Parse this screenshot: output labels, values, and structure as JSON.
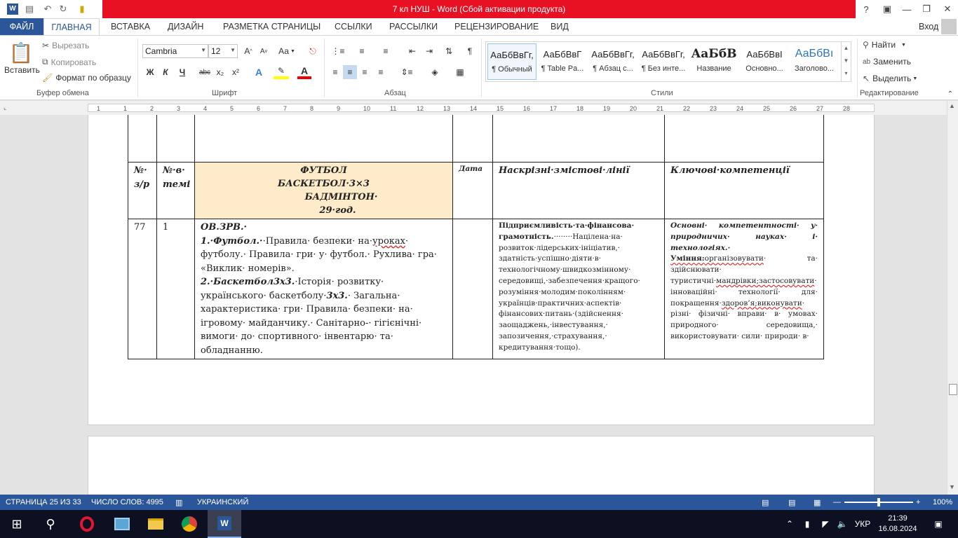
{
  "window": {
    "title": "7 кл НУШ -  Word (Сбой активации продукта)",
    "help": "?",
    "user": "Вход"
  },
  "ribbon_tabs": [
    {
      "label": "ФАЙЛ"
    },
    {
      "label": "ГЛАВНАЯ"
    },
    {
      "label": "ВСТАВКА"
    },
    {
      "label": "ДИЗАЙН"
    },
    {
      "label": "РАЗМЕТКА СТРАНИЦЫ"
    },
    {
      "label": "ССЫЛКИ"
    },
    {
      "label": "РАССЫЛКИ"
    },
    {
      "label": "РЕЦЕНЗИРОВАНИЕ"
    },
    {
      "label": "ВИД"
    }
  ],
  "clipboard": {
    "paste": "Вставить",
    "cut": "Вырезать",
    "copy": "Копировать",
    "format_painter": "Формат по образцу",
    "group": "Буфер обмена"
  },
  "font": {
    "name": "Cambria",
    "size": "12",
    "group": "Шрифт",
    "bold": "Ж",
    "italic": "К",
    "underline": "Ч",
    "strike": "abc",
    "sub": "x₂",
    "sup": "x²",
    "aa": "Аа"
  },
  "paragraph": {
    "group": "Абзац"
  },
  "styles": {
    "group": "Стили",
    "items": [
      {
        "preview": "АаБбВвГг,",
        "name": "¶ Обычный"
      },
      {
        "preview": "АаБбВвГ",
        "name": "¶ Table Pa..."
      },
      {
        "preview": "АаБбВвГг,",
        "name": "¶ Абзац с..."
      },
      {
        "preview": "АаБбВвГг,",
        "name": "¶ Без инте..."
      },
      {
        "preview": "АаБбВ",
        "name": "Название"
      },
      {
        "preview": "АаБбВвІ",
        "name": "Основно..."
      },
      {
        "preview": "АаБбВı",
        "name": "Заголово..."
      }
    ]
  },
  "editing": {
    "group": "Редактирование",
    "find": "Найти",
    "replace": "Заменить",
    "select": "Выделить"
  },
  "ruler": {
    "numbers": [
      "1",
      "1",
      "2",
      "3",
      "4",
      "5",
      "6",
      "7",
      "8",
      "9",
      "10",
      "11",
      "12",
      "13",
      "14",
      "15",
      "16",
      "17",
      "18",
      "19",
      "20",
      "21",
      "22",
      "23",
      "24",
      "25",
      "26",
      "27",
      "28"
    ]
  },
  "table": {
    "header": {
      "num": "№· з/р",
      "topic_num": "№·в· темі",
      "topic_lines": [
        "ФУТБОЛ",
        "БАСКЕТБОЛ·3×3",
        "БАДМІНТОН·",
        "29·год."
      ],
      "date": "Дата",
      "cross_lines": "Наскрізні·змістові·лінії",
      "competences": "Ключові·компетенції"
    },
    "row": {
      "num": "77",
      "topic_num": "1",
      "c_title": "ОВ.ЗРВ.·",
      "c_1_label": "1.·Футбол.·",
      "c_1_text": "·Правила· безпеки· на·",
      "c_1_ul": "уроках",
      "c_1_text2": "· футболу.· Правила· гри· у· футбол.· Рухлива· гра· «Виклик· номерів».",
      "c_2_label": "2.·Баскетбол",
      "c_2_bold": "3х3.",
      "c_2_text": "·Історія· розвитку· українського· баскетболу·",
      "c_2_bold2": "3х3.",
      "c_2_text2": "· Загальна· характеристика·  гри· Правила· безпеки· на· ігровому· майданчику.· Санітарно-· гігієнічні· вимоги· до· спортивного· інвентарю· та· обладнанню.",
      "cross_title": "Підприємливість·та·фінансова· грамотність.",
      "cross_text": "········Націлена·на· розвиток·лідерських·ініціатив,· здатність·успішно·діяти·в· технологічному·швидкозмінному· середовищі,·забезпечення·кращого· розуміння·молодим·поколінням· українців·практичних·аспектів· фінансових·питань·(здійснення· заощаджень,·інвестування,· запозичення,·страхування,· кредитування·тощо).",
      "comp_title": "Основні· компетентності· у· природничих· науках· і· технологіях.·",
      "comp_label": "Уміння:",
      "comp_ul1": "організовувати",
      "comp_text1": "· та· здійснювати· туристичні·",
      "comp_ul2": "мандрівки;застосовувати",
      "comp_text2": "· інноваційні· технології· для· покращення·",
      "comp_ul3": "здоров’я;виконувати",
      "comp_text3": "· різні· фізичні· вправи· в· умовах· природного· середовища,· використовувати· сили· природи· в·"
    }
  },
  "status": {
    "page": "СТРАНИЦА 25 ИЗ 33",
    "words": "ЧИСЛО СЛОВ: 4995",
    "lang": "УКРАИНСКИЙ",
    "zoom": "100%"
  },
  "taskbar": {
    "lang": "УКР",
    "time": "21:39",
    "date": "16.08.2024"
  }
}
